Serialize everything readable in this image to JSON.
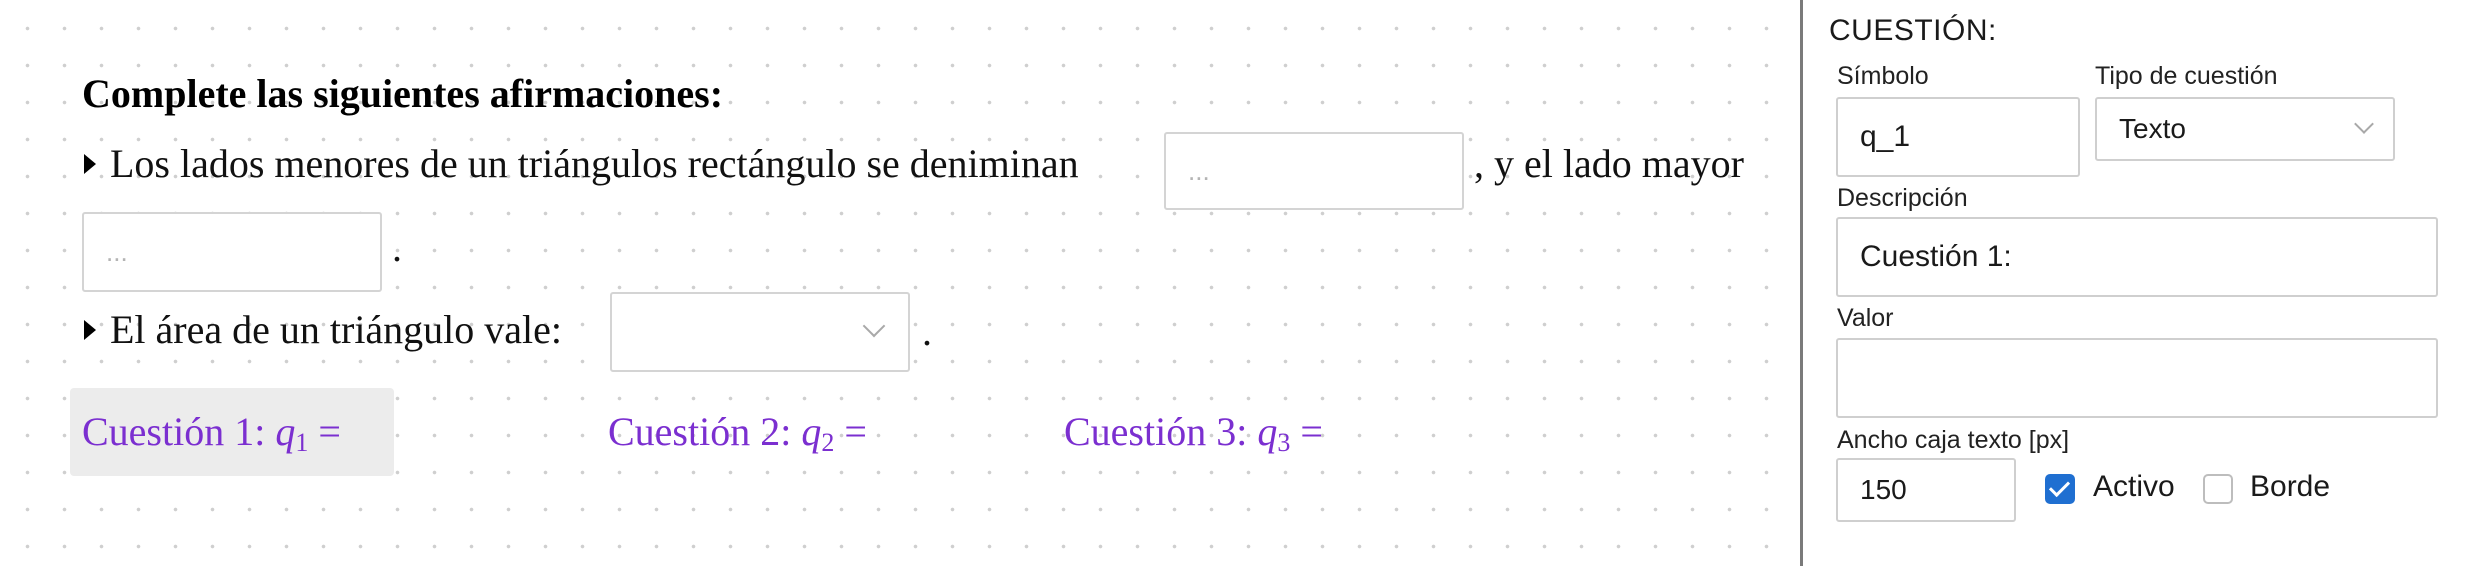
{
  "worksheet": {
    "heading": "Complete las siguientes afirmaciones:",
    "line1_text": "Los lados menores de un triángulos rectángulo se deniminan",
    "line1_suffix": ", y el lado mayor",
    "blank1_placeholder": "...",
    "blank2_placeholder": "...",
    "line2_suffix": ".",
    "line3_text": "El área de un triángulo vale:",
    "line3_suffix": "."
  },
  "questions": [
    {
      "label": "Cuestión 1:",
      "var": "q",
      "sub": "1",
      "eq": "="
    },
    {
      "label": "Cuestión 2:",
      "var": "q",
      "sub": "2",
      "eq": "="
    },
    {
      "label": "Cuestión 3:",
      "var": "q",
      "sub": "3",
      "eq": "="
    }
  ],
  "panel": {
    "title": "CUESTIÓN:",
    "symbol_label": "Símbolo",
    "symbol_value": "q_1",
    "type_label": "Tipo de cuestión",
    "type_value": "Texto",
    "description_label": "Descripción",
    "description_value": "Cuestión 1:",
    "value_label": "Valor",
    "value_value": "",
    "width_label": "Ancho caja texto [px]",
    "width_value": "150",
    "active_label": "Activo",
    "active_checked": true,
    "border_label": "Borde",
    "border_checked": false
  },
  "colors": {
    "question_text": "#7b2fd0",
    "checkbox_on": "#1f6fd1",
    "divider": "#7a7a7a"
  }
}
